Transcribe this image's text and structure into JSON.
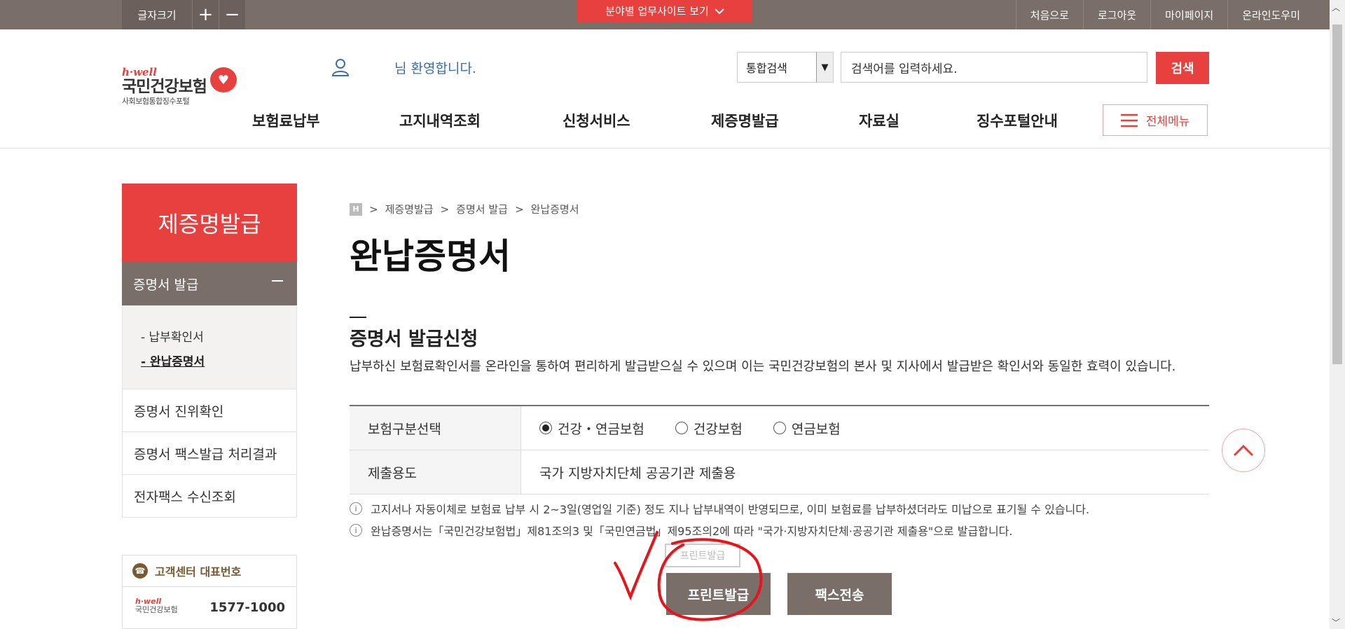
{
  "topbar": {
    "font_size_label": "글자크기",
    "font_increase": "+",
    "font_decrease": "−",
    "site_button": "분야별 업무사이트 보기",
    "links": [
      "처음으로",
      "로그아웃",
      "마이페이지",
      "온라인도우미"
    ]
  },
  "logo": {
    "brand": "h·well",
    "name": "국민건강보험",
    "subtitle": "사회보험통합징수포털"
  },
  "header": {
    "welcome": "님 환영합니다.",
    "search_scope": "통합검색",
    "search_placeholder": "검색어를 입력하세요.",
    "search_button": "검색",
    "all_menu": "전체메뉴"
  },
  "gnb": [
    "보험료납부",
    "고지내역조회",
    "신청서비스",
    "제증명발급",
    "자료실",
    "징수포털안내"
  ],
  "sidebar": {
    "title": "제증명발급",
    "active_group": "증명서 발급",
    "sub_items": [
      "- 납부확인서",
      "- 완납증명서"
    ],
    "items": [
      "증명서 진위확인",
      "증명서 팩스발급 처리결과",
      "전자팩스 수신조회"
    ],
    "customer_center": {
      "label": "고객센터 대표번호",
      "logo_brand": "h·well",
      "logo_name": "국민건강보험",
      "number": "1577-1000"
    }
  },
  "breadcrumb": {
    "home": "H",
    "items": [
      "제증명발급",
      "증명서 발급",
      "완납증명서"
    ]
  },
  "main": {
    "page_title": "완납증명서",
    "section_title": "증명서 발급신청",
    "description": "납부하신 보험료확인서를 온라인을 통하여 편리하게 발급받으실 수 있으며 이는 국민건강보험의 본사 및 지사에서 발급받은 확인서와 동일한 효력이 있습니다.",
    "form": {
      "insurance_label": "보험구분선택",
      "options": [
        "건강・연금보험",
        "건강보험",
        "연금보험"
      ],
      "selected_index": 0,
      "purpose_label": "제출용도",
      "purpose_value": "국가 지방자치단체 공공기관 제출용"
    },
    "notes": [
      "고지서나 자동이체로 보험료 납부 시 2~3일(영업일 기준) 정도 지나 납부내역이 반영되므로, 이미 보험료를 납부하셨더라도 미납으로 표기될 수 있습니다.",
      "완납증명서는「국민건강보험법」제81조의3 및「국민연금법」제95조의2에 따라 \"국가·지방자치단체·공공기관 제출용\"으로 발급합니다."
    ],
    "ghost_button": "프린트발급",
    "print_button": "프린트발급",
    "fax_button": "팩스전송"
  },
  "colors": {
    "accent": "#e8403e",
    "brown": "#7a6e69",
    "annotation": "#e8141c"
  }
}
